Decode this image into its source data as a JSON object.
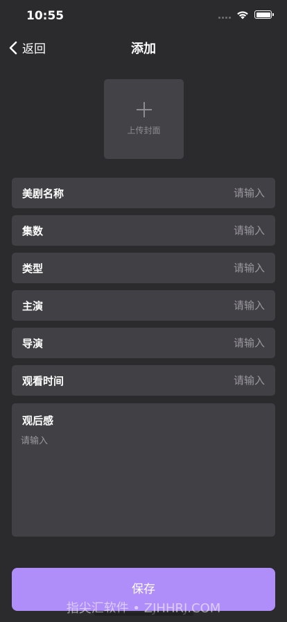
{
  "status_bar": {
    "time": "10:55"
  },
  "nav": {
    "back_label": "返回",
    "title": "添加"
  },
  "cover": {
    "label": "上传封面"
  },
  "fields": [
    {
      "label": "美剧名称",
      "placeholder": "请输入",
      "value": ""
    },
    {
      "label": "集数",
      "placeholder": "请输入",
      "value": ""
    },
    {
      "label": "类型",
      "placeholder": "请输入",
      "value": ""
    },
    {
      "label": "主演",
      "placeholder": "请输入",
      "value": ""
    },
    {
      "label": "导演",
      "placeholder": "请输入",
      "value": ""
    },
    {
      "label": "观看时间",
      "placeholder": "请输入",
      "value": ""
    }
  ],
  "review": {
    "label": "观后感",
    "placeholder": "请输入",
    "value": ""
  },
  "save_label": "保存",
  "watermark": "指尖汇软件 • ZJHHRJ.COM",
  "colors": {
    "background": "#2b2a2c",
    "field_background": "#414045",
    "accent": "#b08ef9"
  }
}
